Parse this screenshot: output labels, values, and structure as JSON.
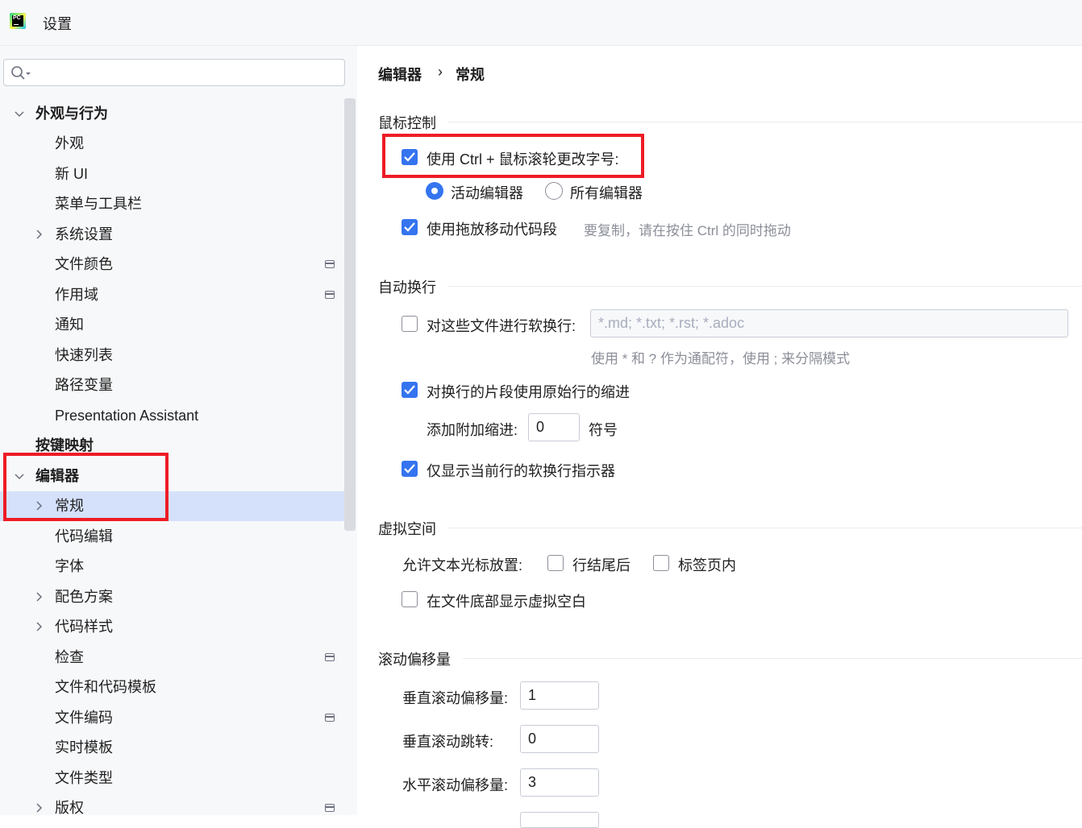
{
  "window": {
    "title": "设置",
    "logo_text": "PC"
  },
  "search": {
    "placeholder": "",
    "value": ""
  },
  "tree": [
    {
      "label": "外观与行为",
      "bold": true,
      "expanded": true
    },
    {
      "label": "外观"
    },
    {
      "label": "新 UI"
    },
    {
      "label": "菜单与工具栏"
    },
    {
      "label": "系统设置",
      "collapsed": true
    },
    {
      "label": "文件颜色",
      "project_icon": true
    },
    {
      "label": "作用域",
      "project_icon": true
    },
    {
      "label": "通知"
    },
    {
      "label": "快速列表"
    },
    {
      "label": "路径变量"
    },
    {
      "label": "Presentation Assistant"
    },
    {
      "label": "按键映射",
      "bold": true
    },
    {
      "label": "编辑器",
      "bold": true,
      "expanded": true
    },
    {
      "label": "常规",
      "collapsed": true,
      "selected": true
    },
    {
      "label": "代码编辑"
    },
    {
      "label": "字体"
    },
    {
      "label": "配色方案",
      "collapsed": true
    },
    {
      "label": "代码样式",
      "collapsed": true
    },
    {
      "label": "检查",
      "project_icon": true
    },
    {
      "label": "文件和代码模板"
    },
    {
      "label": "文件编码",
      "project_icon": true
    },
    {
      "label": "实时模板"
    },
    {
      "label": "文件类型"
    },
    {
      "label": "版权",
      "collapsed": true,
      "project_icon": true
    }
  ],
  "breadcrumb": {
    "parent": "编辑器",
    "separator": "›",
    "current": "常规"
  },
  "mouse": {
    "title": "鼠标控制",
    "ctrl_wheel_label": "使用 Ctrl + 鼠标滚轮更改字号:",
    "ctrl_wheel_checked": true,
    "radio_active": "活动编辑器",
    "radio_all": "所有编辑器",
    "selected_radio": "活动编辑器",
    "dnd_label": "使用拖放移动代码段",
    "dnd_checked": true,
    "dnd_hint": "要复制，请在按住 Ctrl 的同时拖动"
  },
  "soft_wrap": {
    "title": "自动换行",
    "files_label": "对这些文件进行软换行:",
    "files_checked": false,
    "files_value": "*.md; *.txt; *.rst; *.adoc",
    "files_hint": "使用 * 和 ? 作为通配符，使用 ; 来分隔模式",
    "indent_label": "对换行的片段使用原始行的缩进",
    "indent_checked": true,
    "extra_indent_label": "添加附加缩进:",
    "extra_indent_value": "0",
    "extra_indent_unit": "符号",
    "current_only_label": "仅显示当前行的软换行指示器",
    "current_only_checked": true
  },
  "virtual_space": {
    "title": "虚拟空间",
    "caret_label": "允许文本光标放置:",
    "after_eol": "行结尾后",
    "after_eol_checked": false,
    "inside_tabs": "标签页内",
    "inside_tabs_checked": false,
    "show_bottom": "在文件底部显示虚拟空白",
    "show_bottom_checked": false
  },
  "scroll_offset": {
    "title": "滚动偏移量",
    "vertical_label": "垂直滚动偏移量:",
    "vertical_value": "1",
    "jump_label": "垂直滚动跳转:",
    "jump_value": "0",
    "horizontal_label": "水平滚动偏移量:",
    "horizontal_value": "3"
  },
  "colors": {
    "accent": "#3574f0",
    "selection": "#d5e1fb",
    "highlight": "#ee1c25"
  }
}
